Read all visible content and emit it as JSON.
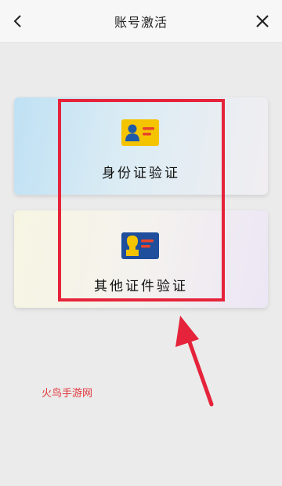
{
  "navbar": {
    "title": "账号激活",
    "back_icon": "chevron-left-icon",
    "close_icon": "close-icon"
  },
  "options": [
    {
      "label": "身份证验证",
      "icon": "id-card-icon",
      "icon_bg": "#f5c400",
      "icon_person": "#1e5aa8",
      "icon_lines": "#e8452c"
    },
    {
      "label": "其他证件验证",
      "icon": "document-card-icon",
      "icon_bg": "#1e4e9c",
      "icon_person": "#f5c400",
      "icon_lines": "#e8452c"
    }
  ],
  "annotation": {
    "color": "#e5233a"
  },
  "watermark": "火鸟手游网"
}
